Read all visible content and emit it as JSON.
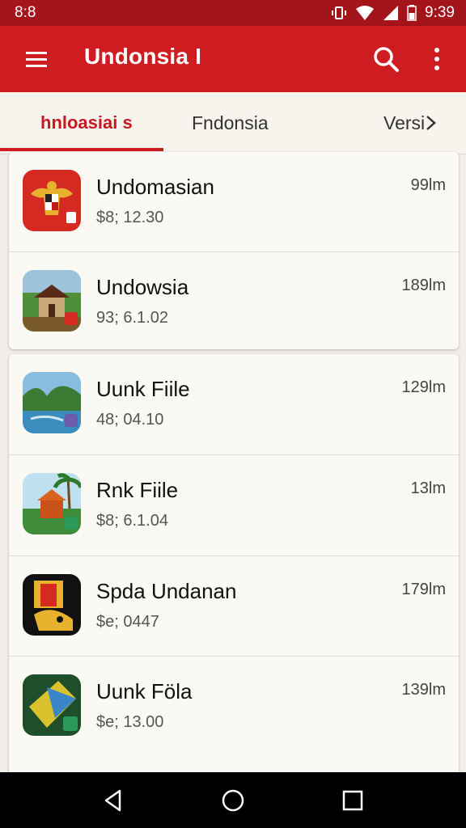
{
  "status_bar": {
    "left_text": "8:8",
    "time": "9:39"
  },
  "app_bar": {
    "title": "Undonsia I"
  },
  "tabs": [
    {
      "label": "hnloasiai s",
      "active": true
    },
    {
      "label": "Fndonsia",
      "active": false
    },
    {
      "label": "Versi",
      "active": false
    }
  ],
  "list": [
    {
      "name": "Undomasian",
      "sub": "$8; 12.30",
      "size": "99lm",
      "icon": "garuda-icon"
    },
    {
      "name": "Undowsia",
      "sub": "93; 6.1.02",
      "size": "189lm",
      "icon": "house-icon"
    },
    {
      "name": "Uunk Fiile",
      "sub": "48; 04.10",
      "size": "129lm",
      "icon": "river-icon"
    },
    {
      "name": "Rnk Fiile",
      "sub": "$8; 6.1.04",
      "size": "13lm",
      "icon": "temple-icon"
    },
    {
      "name": "Spda Undanan",
      "sub": "$e; 0447",
      "size": "179lm",
      "icon": "banner-icon"
    },
    {
      "name": "Uunk Föla",
      "sub": "$e; 13.00",
      "size": "139lm",
      "icon": "map-icon"
    }
  ],
  "colors": {
    "primary": "#cf1c20",
    "status": "#a3141b",
    "background": "#f2efe8"
  }
}
